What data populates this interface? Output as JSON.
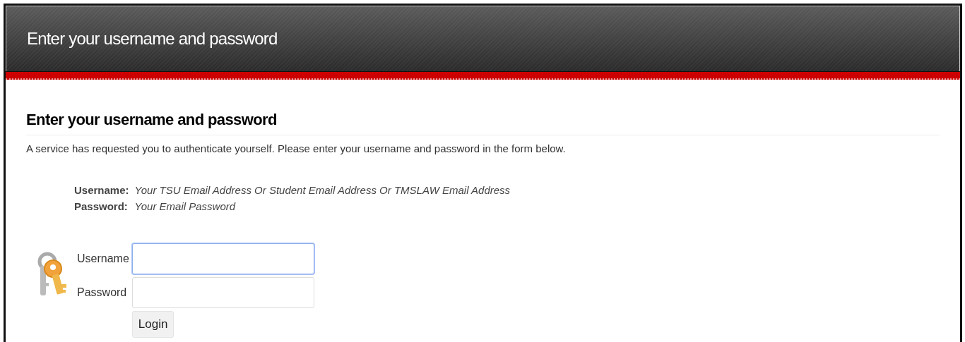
{
  "header": {
    "title": "Enter your username and password"
  },
  "content": {
    "heading": "Enter your username and password",
    "intro": "A service has requested you to authenticate yourself. Please enter your username and password in the form below.",
    "hints": [
      {
        "label": "Username:",
        "text": "Your TSU Email Address Or Student Email Address Or TMSLAW Email Address"
      },
      {
        "label": "Password:",
        "text": "Your Email Password"
      }
    ],
    "form": {
      "fields": [
        {
          "label": "Username",
          "focused": true
        },
        {
          "label": "Password",
          "focused": false
        }
      ],
      "button": "Login"
    }
  }
}
